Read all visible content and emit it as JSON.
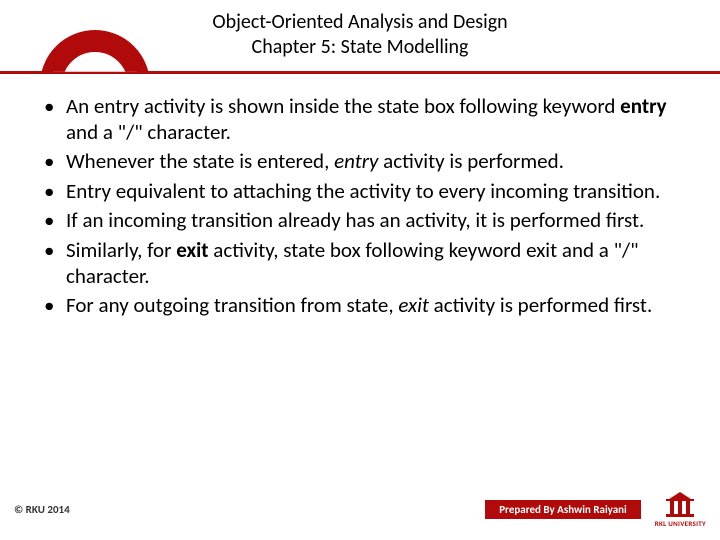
{
  "header": {
    "title_line1": "Object-Oriented Analysis and Design",
    "title_line2": "Chapter 5: State Modelling"
  },
  "bullets": [
    {
      "pre": "An entry activity is shown inside the state box following keyword ",
      "bold1": "entry",
      "mid": " and a \"/\" character."
    },
    {
      "pre": "Whenever the state is entered, ",
      "ital1": "entry",
      "mid": " activity is performed."
    },
    {
      "pre": "Entry equivalent to attaching the activity to every incoming transition."
    },
    {
      "pre": "If an incoming transition already has an activity, it is performed first."
    },
    {
      "pre": "Similarly, for ",
      "bold1": "exit",
      "mid": " activity, state box following keyword exit and a \"/\" character."
    },
    {
      "pre": "For any outgoing transition from state, ",
      "ital1": "exit",
      "mid": " activity is performed first."
    }
  ],
  "footer": {
    "copyright": "© RKU 2014",
    "prepared": "Prepared By Ashwin Raiyani",
    "logo_text": "RKL UNIVERSITY"
  }
}
